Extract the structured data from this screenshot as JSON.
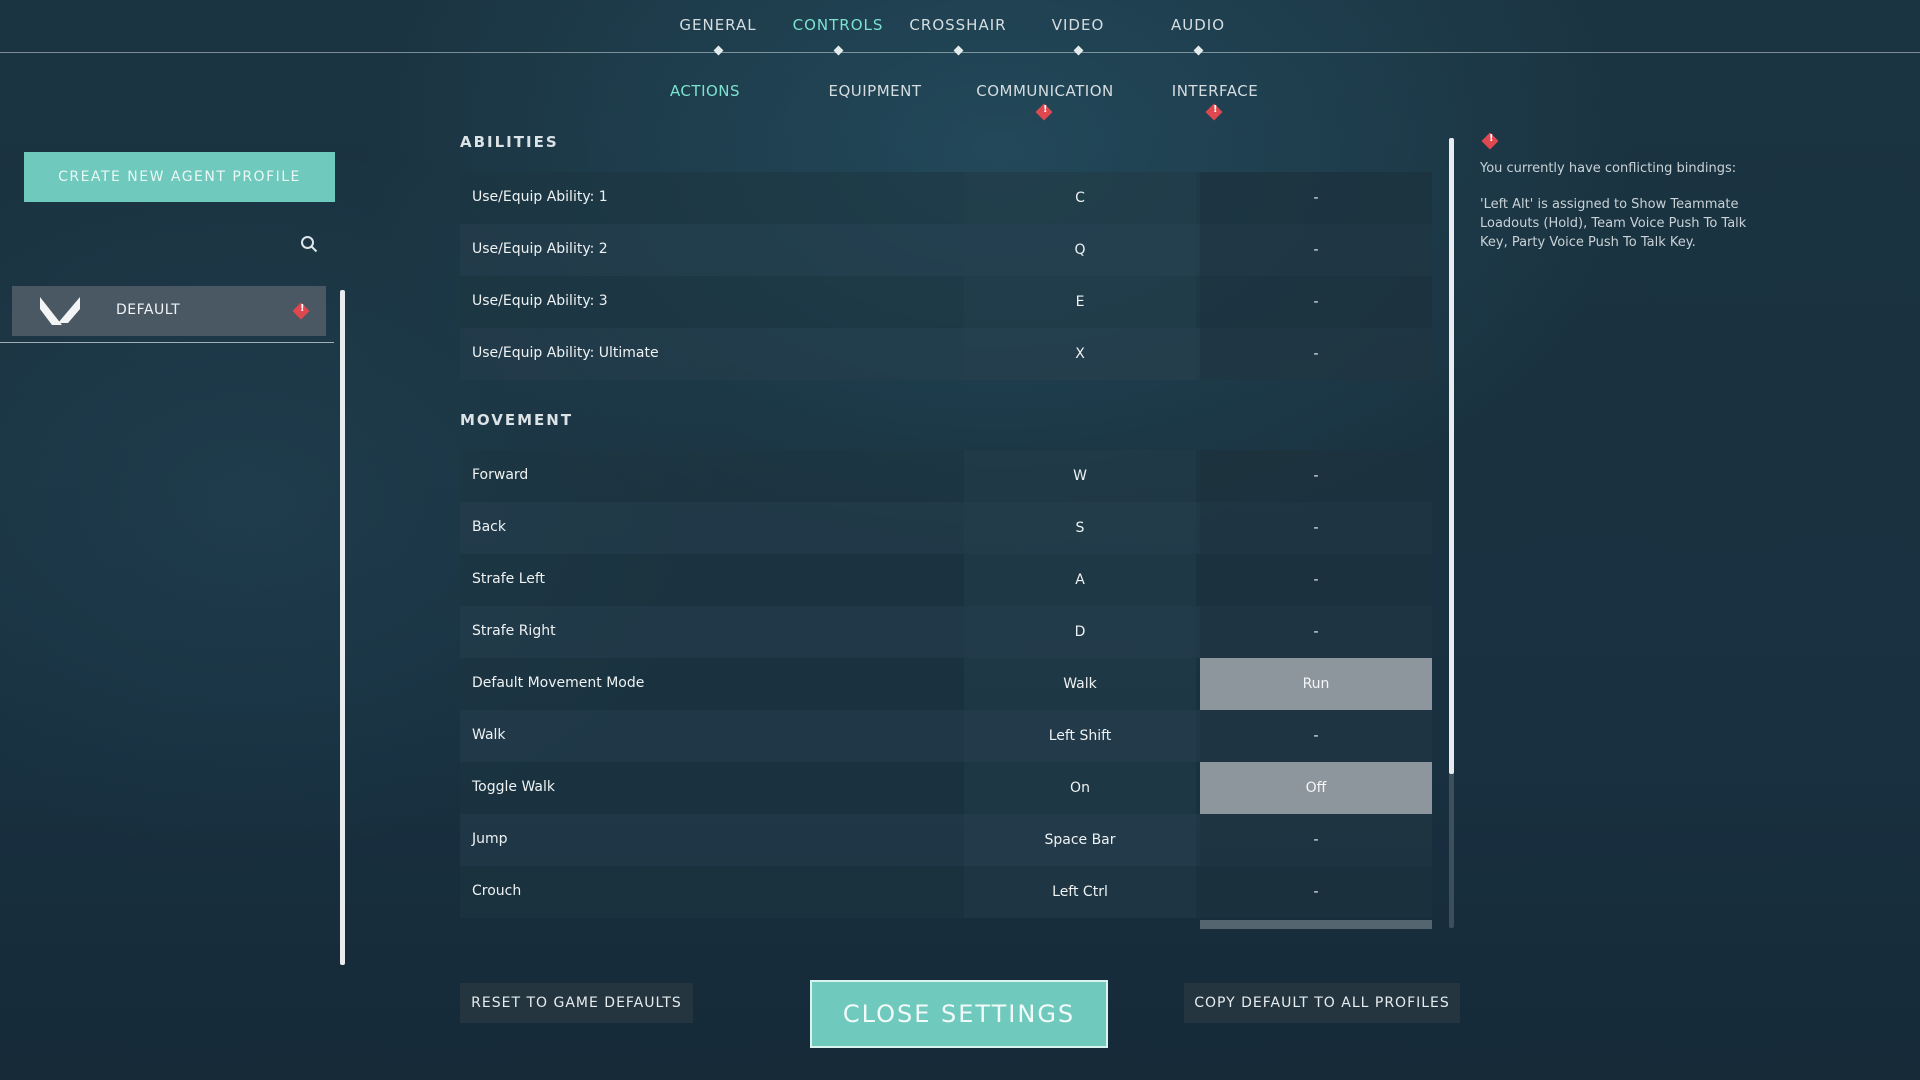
{
  "top_tabs": [
    {
      "label": "GENERAL"
    },
    {
      "label": "CONTROLS"
    },
    {
      "label": "CROSSHAIR"
    },
    {
      "label": "VIDEO"
    },
    {
      "label": "AUDIO"
    }
  ],
  "sub_tabs": [
    {
      "label": "ACTIONS"
    },
    {
      "label": "EQUIPMENT"
    },
    {
      "label": "COMMUNICATION"
    },
    {
      "label": "INTERFACE"
    }
  ],
  "sidebar": {
    "create_button": "CREATE NEW AGENT PROFILE",
    "profiles": [
      {
        "name": "DEFAULT"
      }
    ]
  },
  "sections": {
    "abilities": {
      "title": "ABILITIES",
      "rows": [
        {
          "action": "Use/Equip Ability: 1",
          "primary": "C",
          "secondary": "-"
        },
        {
          "action": "Use/Equip Ability: 2",
          "primary": "Q",
          "secondary": "-"
        },
        {
          "action": "Use/Equip Ability: 3",
          "primary": "E",
          "secondary": "-"
        },
        {
          "action": "Use/Equip Ability: Ultimate",
          "primary": "X",
          "secondary": "-"
        }
      ]
    },
    "movement": {
      "title": "MOVEMENT",
      "rows": [
        {
          "action": "Forward",
          "primary": "W",
          "secondary": "-"
        },
        {
          "action": "Back",
          "primary": "S",
          "secondary": "-"
        },
        {
          "action": "Strafe Left",
          "primary": "A",
          "secondary": "-"
        },
        {
          "action": "Strafe Right",
          "primary": "D",
          "secondary": "-"
        },
        {
          "action": "Default Movement Mode",
          "primary": "Walk",
          "secondary": "Run"
        },
        {
          "action": "Walk",
          "primary": "Left Shift",
          "secondary": "-"
        },
        {
          "action": "Toggle Walk",
          "primary": "On",
          "secondary": "Off"
        },
        {
          "action": "Jump",
          "primary": "Space Bar",
          "secondary": "-"
        },
        {
          "action": "Crouch",
          "primary": "Left Ctrl",
          "secondary": "-"
        }
      ]
    }
  },
  "conflict": {
    "title": "You currently have conflicting bindings:",
    "message": "'Left Alt' is assigned to Show Teammate Loadouts (Hold), Team Voice Push To Talk Key, Party Voice Push To Talk Key."
  },
  "buttons": {
    "reset": "RESET TO GAME DEFAULTS",
    "close": "CLOSE SETTINGS",
    "copy": "COPY DEFAULT TO ALL PROFILES"
  },
  "colors": {
    "accent": "#7be3cf",
    "button_teal": "#6fc9bd",
    "warning": "#e0484f",
    "highlight_cell": "#8d969c"
  }
}
